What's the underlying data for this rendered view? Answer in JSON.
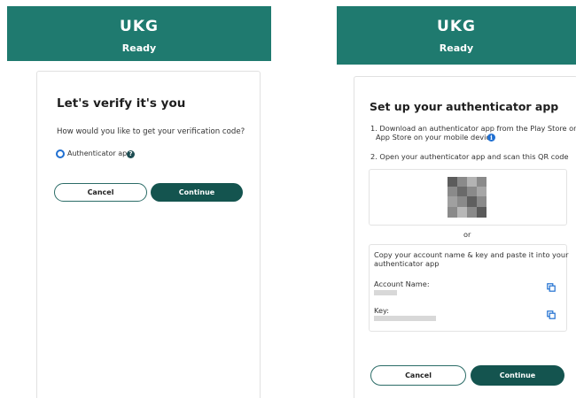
{
  "left": {
    "header": {
      "logo": "UKG",
      "subtitle": "Ready"
    },
    "title": "Let's verify it's you",
    "question": "How would you like to get your verification code?",
    "option_label": "Authenticator app",
    "cancel_label": "Cancel",
    "continue_label": "Continue"
  },
  "right": {
    "header": {
      "logo": "UKG",
      "subtitle": "Ready"
    },
    "title": "Set up your authenticator app",
    "step1_line1": "1. Download an authenticator app from the Play Store or",
    "step1_line2": "App Store on your mobile device",
    "step2": "2. Open your authenticator app and scan this QR code",
    "or_label": "or",
    "copy_line1": "Copy your account name & key and paste it into your",
    "copy_line2": "authenticator app",
    "account_name_label": "Account Name:",
    "key_label": "Key:",
    "cancel_label": "Cancel",
    "continue_label": "Continue"
  },
  "colors": {
    "brand": "#1f7a6f",
    "button": "#14544f",
    "info": "#1f6fd1"
  },
  "icons": [
    "question-icon",
    "info-icon",
    "qr-code",
    "copy-icon"
  ]
}
